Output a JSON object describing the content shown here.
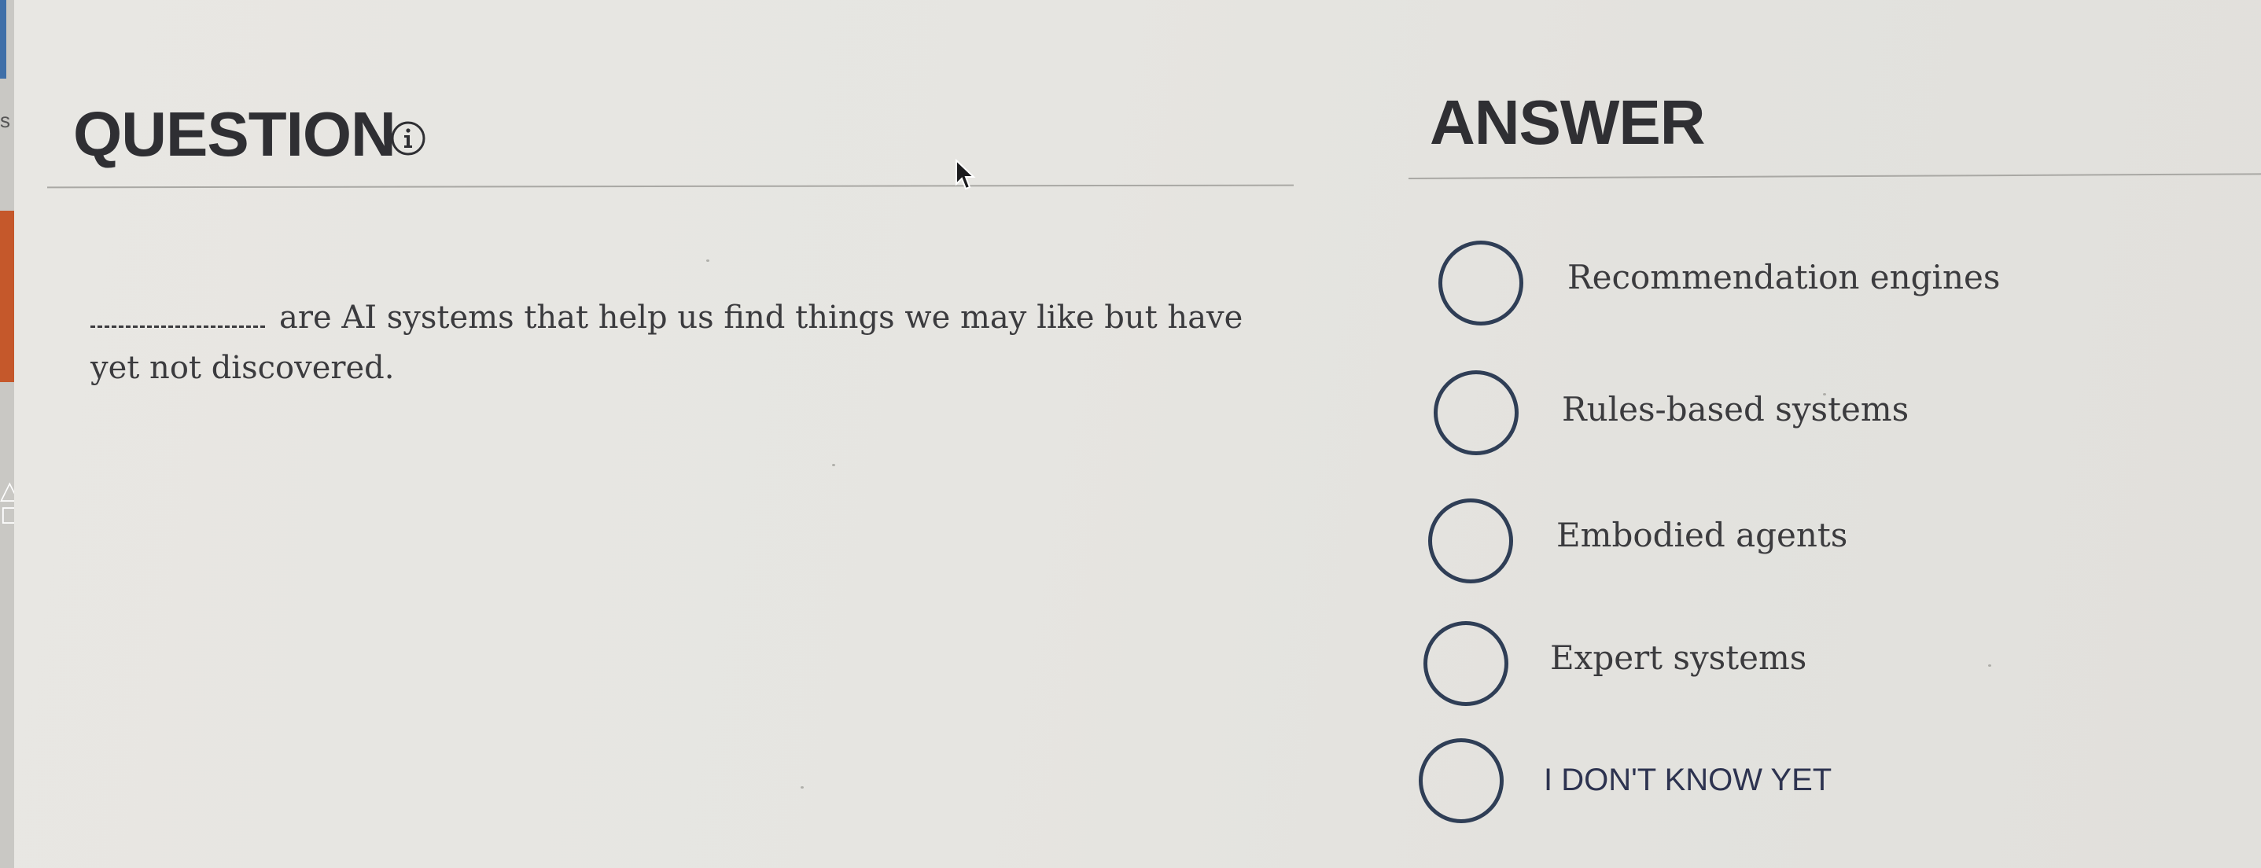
{
  "sidebar": {
    "label_fragment": "s"
  },
  "question": {
    "heading": "QUESTION",
    "info_icon": "info-icon",
    "text": "are AI systems that help us find things we may like but have yet not discovered."
  },
  "answer": {
    "heading": "ANSWER",
    "options": [
      {
        "label": "Recommendation engines"
      },
      {
        "label": "Rules-based systems"
      },
      {
        "label": "Embodied agents"
      },
      {
        "label": "Expert systems"
      },
      {
        "label": "I DON'T KNOW YET"
      }
    ]
  },
  "colors": {
    "sidebar_accent": "#c5582b",
    "radio_border": "#2f3e56",
    "heading": "#2f2f33"
  }
}
